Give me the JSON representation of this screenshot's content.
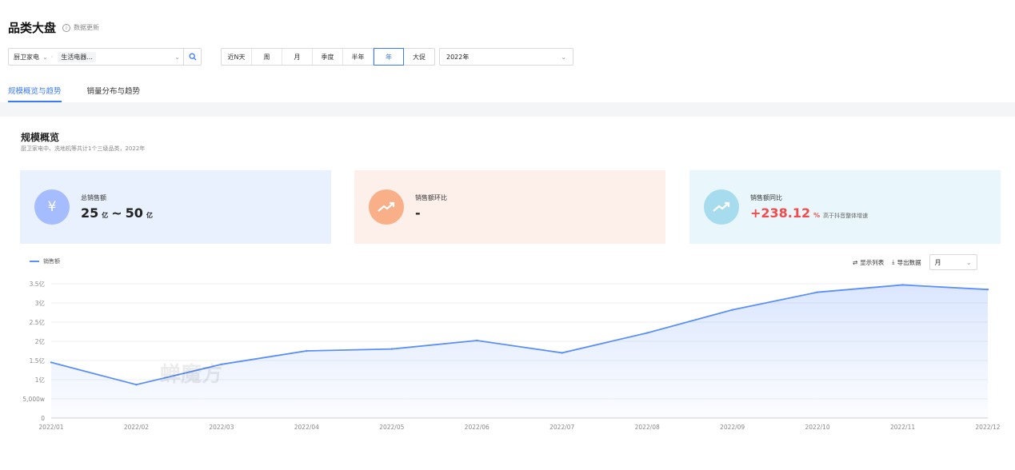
{
  "header": {
    "title": "品类大盘",
    "update_label": "数据更新"
  },
  "filters": {
    "category_primary": "厨卫家电",
    "category_secondary": "生活电器...",
    "periods": [
      "近N天",
      "周",
      "月",
      "季度",
      "半年",
      "年",
      "大促"
    ],
    "active_period": "年",
    "year_value": "2022年"
  },
  "tabs": [
    {
      "label": "规模概览与趋势",
      "active": true
    },
    {
      "label": "销量分布与趋势",
      "active": false
    }
  ],
  "overview": {
    "title": "规模概览",
    "subtitle": "厨卫家电中、洗地机等共计1个三级品类，2022年"
  },
  "cards": [
    {
      "icon": "yen-icon",
      "label": "总销售额",
      "value_a": "25",
      "unit_a": "亿",
      "sep": "~",
      "value_b": "50",
      "unit_b": "亿"
    },
    {
      "icon": "trend-up-icon",
      "label": "销售额环比",
      "value": "-"
    },
    {
      "icon": "trend-up-icon",
      "label": "销售额同比",
      "value": "+238.12",
      "unit": "%",
      "note": "高于抖音整体增速"
    }
  ],
  "chart_toolbar": {
    "show_list": "显示列表",
    "export": "导出数据",
    "granularity": "月"
  },
  "watermark": "蝉魔方",
  "colors": {
    "accent": "#3c7bf7",
    "line": "#5b8ff9",
    "positive": "#f14b4b"
  },
  "chart_data": {
    "type": "area",
    "series": [
      {
        "name": "销售额",
        "values": [
          1.45,
          0.87,
          1.4,
          1.75,
          1.8,
          2.02,
          1.7,
          2.22,
          2.82,
          3.28,
          3.47,
          3.35
        ]
      }
    ],
    "x": [
      "2022/01",
      "2022/02",
      "2022/03",
      "2022/04",
      "2022/05",
      "2022/06",
      "2022/07",
      "2022/08",
      "2022/09",
      "2022/10",
      "2022/11",
      "2022/12"
    ],
    "y_ticks": [
      0,
      0.5,
      1,
      1.5,
      2,
      2.5,
      3,
      3.5
    ],
    "y_tick_labels": [
      "0",
      "5,000w",
      "1亿",
      "1.5亿",
      "2亿",
      "2.5亿",
      "3亿",
      "3.5亿"
    ],
    "ylim": [
      0,
      3.5
    ],
    "grid": true,
    "legend": "top-left"
  }
}
